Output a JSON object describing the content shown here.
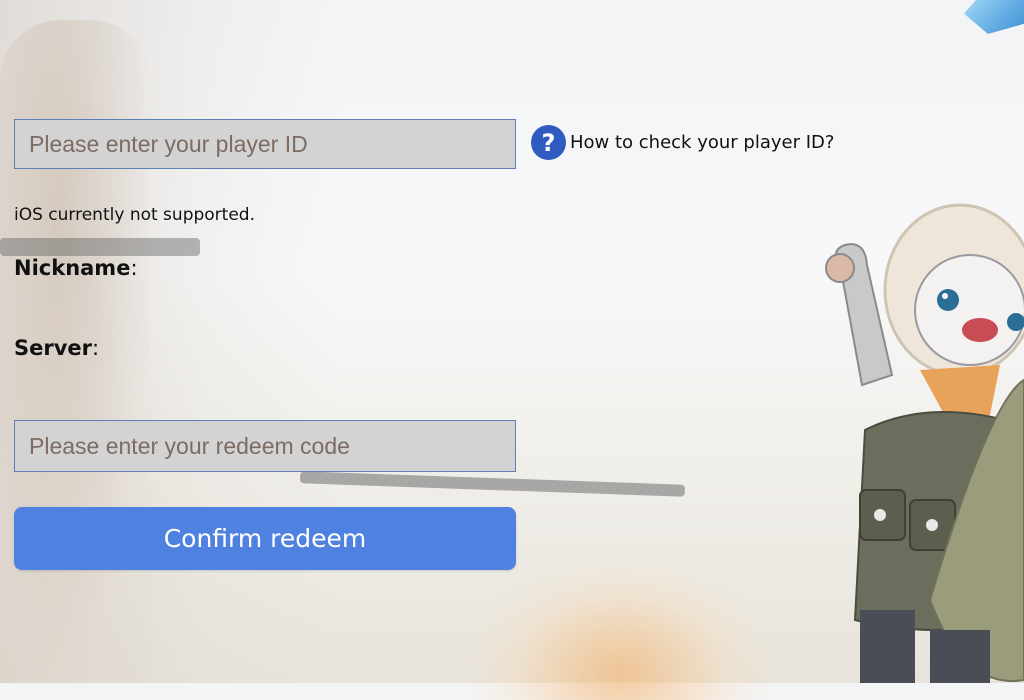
{
  "form": {
    "player_id_placeholder": "Please enter your player ID",
    "help_link": "How to check your player ID?",
    "help_icon": "question-circle-icon",
    "ios_note": "iOS currently not supported.",
    "nickname_label": "Nickname",
    "server_label": "Server",
    "label_suffix": ":",
    "redeem_placeholder": "Please enter your redeem code",
    "confirm_label": "Confirm redeem"
  },
  "colors": {
    "accent": "#4f82e0",
    "help_icon_bg": "#2f5bc0",
    "input_bg": "#d3d3d3",
    "input_border": "#5d7fb3"
  }
}
